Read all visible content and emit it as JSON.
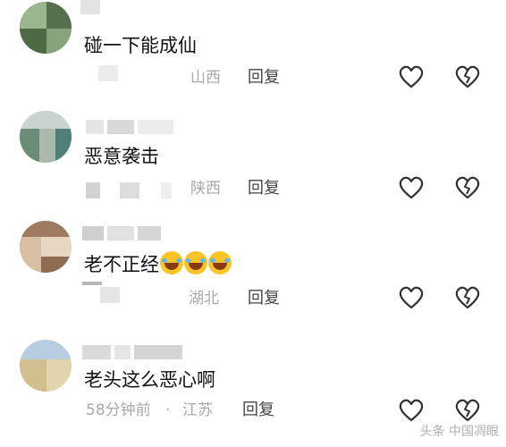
{
  "comments": [
    {
      "text": "碰一下能成仙",
      "location": "山西",
      "reply_label": "回复",
      "emoji_count": 0
    },
    {
      "text": "恶意袭击",
      "location": "陕西",
      "reply_label": "回复",
      "emoji_count": 0
    },
    {
      "text": "老不正经",
      "location": "湖北",
      "reply_label": "回复",
      "emoji_count": 3,
      "emoji": "laughing-crying"
    },
    {
      "text": "老头这么恶心啊",
      "time": "58分钟前",
      "separator": "·",
      "location": "江苏",
      "reply_label": "回复",
      "emoji_count": 0
    }
  ],
  "watermark": "头条 中国凋眼",
  "icons": {
    "like": "heart-outline-icon",
    "dislike": "broken-heart-outline-icon"
  },
  "colors": {
    "meta_gray": "#a8a8a8",
    "text": "#111111",
    "reply": "#444444"
  }
}
